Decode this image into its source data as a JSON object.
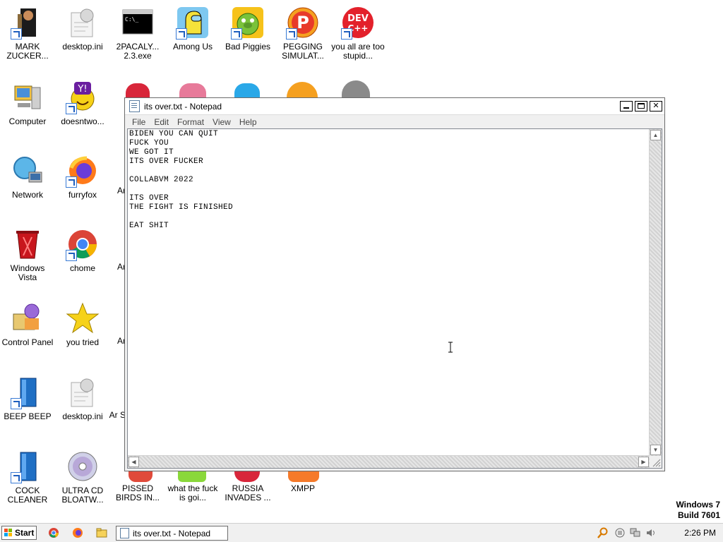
{
  "desktop": {
    "col1": [
      {
        "label": "MARK ZUCKER..."
      },
      {
        "label": "Computer"
      },
      {
        "label": "Network"
      },
      {
        "label": "Windows Vista"
      },
      {
        "label": "Control Panel"
      },
      {
        "label": "BEEP BEEP"
      },
      {
        "label": "COCK CLEANER"
      }
    ],
    "col2": [
      {
        "label": "desktop.ini"
      },
      {
        "label": "doesntwo..."
      },
      {
        "label": "furryfox"
      },
      {
        "label": "chome"
      },
      {
        "label": "you tried"
      },
      {
        "label": "desktop.ini"
      },
      {
        "label": "ULTRA CD BLOATW..."
      }
    ],
    "col3_partial": [
      {
        "label": "Ar"
      },
      {
        "label": "Ar"
      },
      {
        "label": "Ar"
      },
      {
        "label": "Ar S"
      }
    ],
    "top_row": [
      {
        "label": "2PACALY... 2.3.exe"
      },
      {
        "label": "Among Us"
      },
      {
        "label": "Bad Piggies"
      },
      {
        "label": "PEGGING SIMULAT..."
      },
      {
        "label": "you all are too stupid..."
      }
    ],
    "bottom_row": [
      {
        "label": "PISSED BIRDS IN..."
      },
      {
        "label": "what the fuck is goi..."
      },
      {
        "label": "RUSSIA INVADES ..."
      },
      {
        "label": "XMPP"
      }
    ]
  },
  "notepad": {
    "title": "its over.txt - Notepad",
    "menu": [
      "File",
      "Edit",
      "Format",
      "View",
      "Help"
    ],
    "content": "BIDEN YOU CAN QUIT\nFUCK YOU\nWE GOT IT\nITS OVER FUCKER\n\nCOLLABVM 2022\n\nITS OVER\nTHE FIGHT IS FINISHED\n\nEAT SHIT"
  },
  "watermark": {
    "line1": "Windows 7",
    "line2": "Build 7601"
  },
  "taskbar": {
    "start_label": "Start",
    "task_label": "its over.txt - Notepad",
    "clock": "2:26 PM"
  }
}
